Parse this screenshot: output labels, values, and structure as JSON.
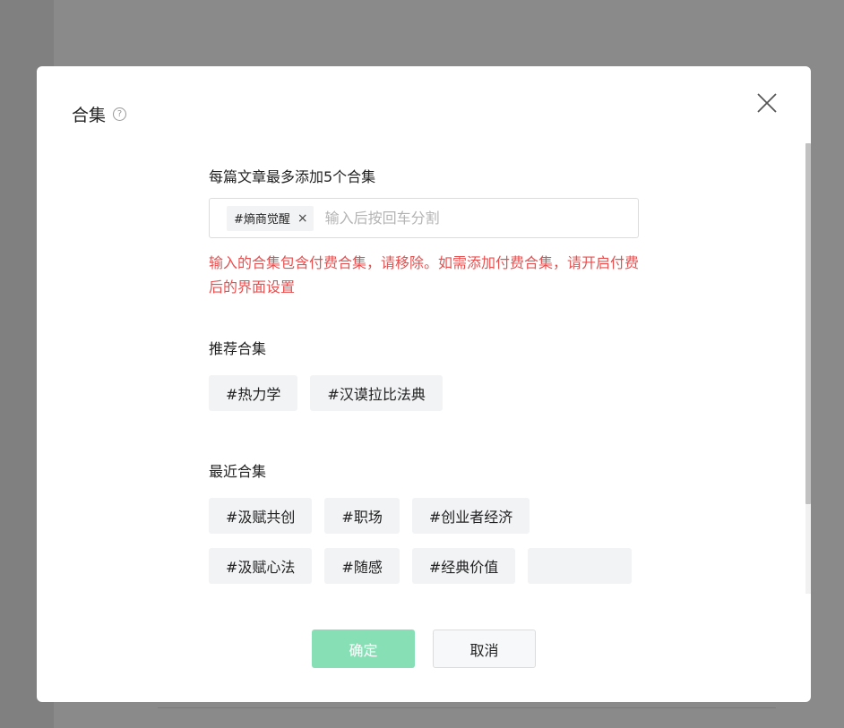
{
  "dialog": {
    "title": "合集",
    "help_symbol": "?"
  },
  "tag_input": {
    "label": "每篇文章最多添加5个合集",
    "chips": [
      "#熵商觉醒"
    ],
    "chip_remove_symbol": "×",
    "placeholder": "输入后按回车分割",
    "value": ""
  },
  "error": {
    "message": "输入的合集包含付费合集，请移除。如需添加付费合集，请开启付费后的界面设置"
  },
  "recommended": {
    "label": "推荐合集",
    "tags": [
      "#热力学",
      "#汉谟拉比法典"
    ]
  },
  "recent": {
    "label": "最近合集",
    "tags": [
      "#汲赋共创",
      "#职场",
      "#创业者经济",
      "#汲赋心法",
      "#随感",
      "#经典价值"
    ]
  },
  "footer": {
    "confirm_label": "确定",
    "cancel_label": "取消"
  },
  "colors": {
    "error": "#e85050",
    "confirm_disabled": "#87e0b5",
    "tag_bg": "#f2f3f5",
    "overlay": "#808080"
  }
}
